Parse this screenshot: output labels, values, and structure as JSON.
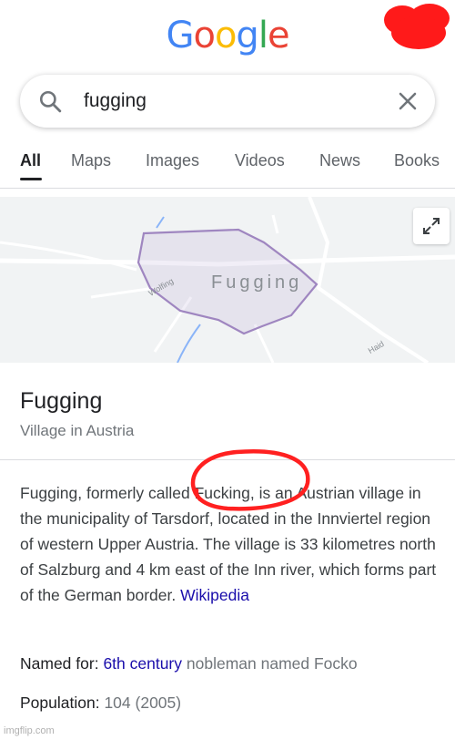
{
  "logo": {
    "letters": [
      "G",
      "o",
      "o",
      "g",
      "l",
      "e"
    ],
    "colors": [
      "#4285F4",
      "#EA4335",
      "#FBBC05",
      "#4285F4",
      "#34A853",
      "#EA4335"
    ]
  },
  "search": {
    "query": "fugging"
  },
  "tabs": [
    "All",
    "Maps",
    "Images",
    "Videos",
    "News",
    "Books"
  ],
  "map": {
    "place_label": "Fugging",
    "road_labels": [
      "Wolfing",
      "Haid"
    ]
  },
  "entity": {
    "title": "Fugging",
    "subtitle": "Village in Austria"
  },
  "description": {
    "text": "Fugging, formerly called Fucking, is an Austrian village in the municipality of Tarsdorf, located in the Innviertel region of western Upper Austria. The village is 33 kilometres north of Salzburg and 4 km east of the Inn river, which forms part of the German border.",
    "source": "Wikipedia"
  },
  "facts": {
    "named_for": {
      "label": "Named for:",
      "link": "6th century",
      "value": "nobleman named Focko"
    },
    "population": {
      "label": "Population:",
      "value": "104 (2005)"
    }
  },
  "colors": {
    "link": "#1a0dab",
    "annotation": "#ff2020"
  },
  "watermark": "imgflip.com"
}
